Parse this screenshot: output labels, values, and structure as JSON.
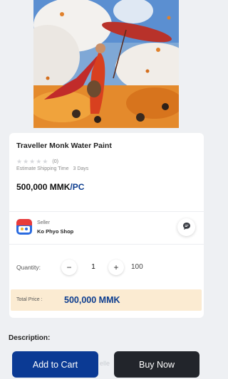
{
  "product": {
    "image": "monk-with-red-umbrella-painting",
    "title": "Traveller Monk Water Paint",
    "rating_count": "(0)",
    "shipping_label": "Estimate Shipping Time",
    "shipping_value": "3  Days",
    "price": "500,000 MMK",
    "price_unit": "/PC"
  },
  "seller": {
    "caption": "Seller",
    "name": "Ko Phyo Shop",
    "logo": "shop-logo",
    "chat_icon": "chat-bubble-icon"
  },
  "quantity": {
    "label": "Quantity:",
    "minus": "−",
    "plus": "+",
    "value": "1",
    "max": "100"
  },
  "total": {
    "label": "Total Price :",
    "value": "500,000 MMK"
  },
  "description": {
    "label": "Description:"
  },
  "actions": {
    "add_to_cart": "Add to Cart",
    "buy_now": "Buy Now"
  },
  "colors": {
    "primary": "#0b3a94",
    "dark": "#22252b",
    "total_bg": "#fbebd2",
    "price_blue": "#0d3d8f"
  }
}
